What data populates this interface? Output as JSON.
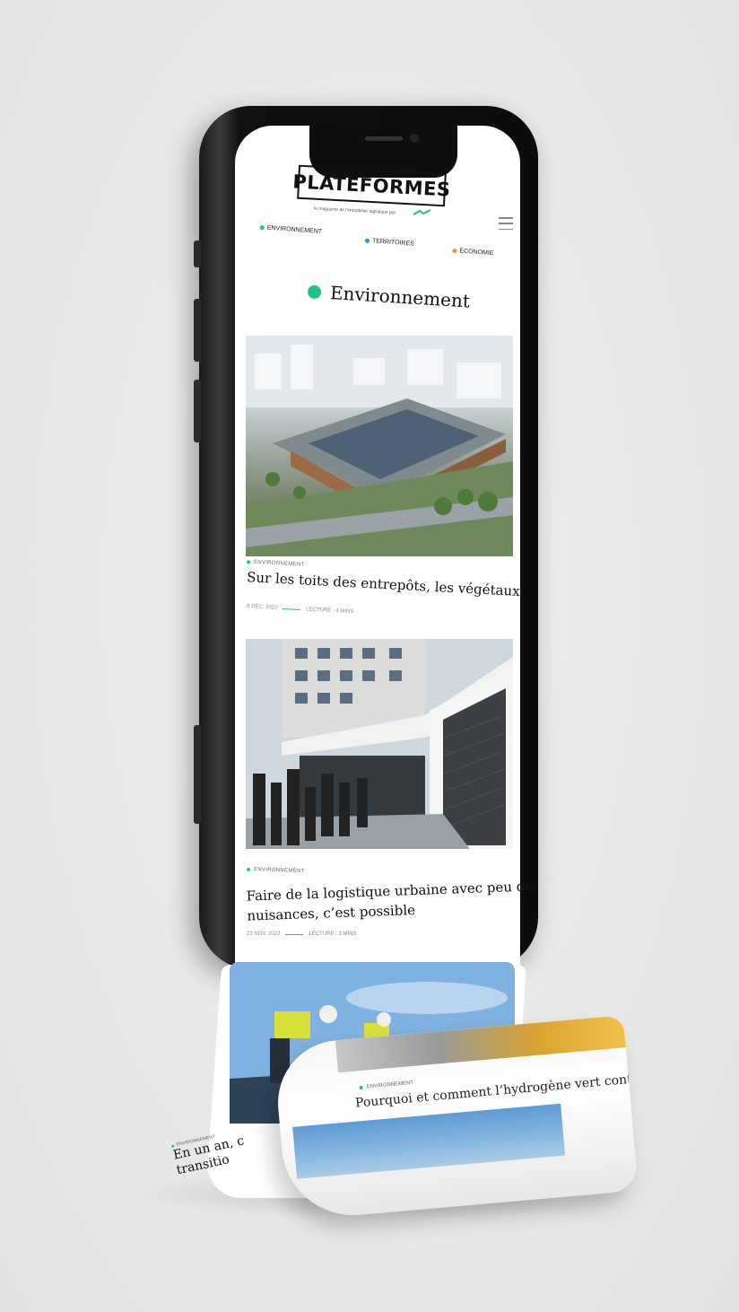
{
  "brand": {
    "name": "PLATEFORMES",
    "tagline": "le magazine de l'immobilier logistique par"
  },
  "nav": {
    "items": [
      {
        "label": "ENVIRONNEMENT",
        "color": "#1fc28a"
      },
      {
        "label": "TERRITOIRES",
        "color": "#3b8fe0"
      },
      {
        "label": "ÉCONOMIE",
        "color": "#f09a2a"
      }
    ]
  },
  "section": {
    "title": "Environnement",
    "accent": "#1fc28a"
  },
  "articles": [
    {
      "category": "ENVIRONNEMENT",
      "title": "Sur les toits des entrepôts, les végétaux",
      "date": "8 DÉC. 2022",
      "reading": "LECTURE : 4 MINS"
    },
    {
      "category": "ENVIRONNEMENT",
      "title_line1": "Faire de la logistique urbaine avec peu de",
      "title_line2": "nuisances, c’est possible",
      "date": "23 NOV. 2022",
      "reading": "LECTURE : 3 MINS"
    },
    {
      "category": "ENVIRONNEMENT",
      "title": "Pourquoi et comment l’hydrogène vert contre"
    },
    {
      "category": "ENVIRONNEMENT",
      "title_line1": "En un an, c",
      "title_line2": "transitio"
    }
  ]
}
